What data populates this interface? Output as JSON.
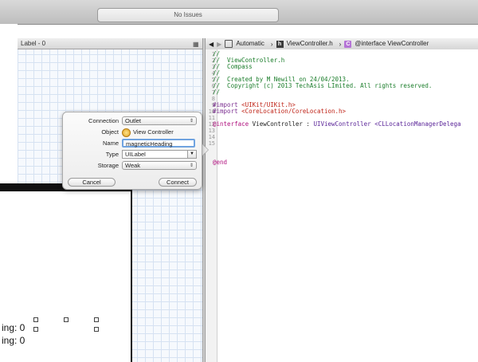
{
  "toolbar": {
    "status_text": "No Issues"
  },
  "canvas": {
    "header_title": "Label - 0",
    "labels": [
      "ing: 0",
      "ing: 0"
    ]
  },
  "jump_bar": {
    "items": [
      "Automatic",
      "ViewController.h",
      "@interface ViewController"
    ]
  },
  "editor": {
    "line_numbers": [
      "1",
      "2",
      "3",
      "4",
      "5",
      "6",
      "7",
      "8",
      "9",
      "10",
      "11",
      "12",
      "13",
      "14",
      "15"
    ],
    "lines": {
      "l1": "//",
      "l2": "//  ViewController.h",
      "l3": "//  Compass",
      "l4": "//",
      "l5": "//  Created by M Newill on 24/04/2013.",
      "l6": "//  Copyright (c) 2013 TechAsis LImited. All rights reserved.",
      "l7": "//",
      "import_kw": "#import",
      "import1_path": "<UIKit/UIKit.h>",
      "import2_path": "<CoreLocation/CoreLocation.h>",
      "iface_kw": "@interface",
      "iface_rest": "ViewController : ",
      "iface_super": "UIViewController",
      "iface_proto": "<CLLocationManagerDelega",
      "end_kw": "@end"
    }
  },
  "connection_popover": {
    "connection_label": "Connection",
    "connection_value": "Outlet",
    "object_label": "Object",
    "object_value": "View Controller",
    "name_label": "Name",
    "name_value": "magneticHeading",
    "type_label": "Type",
    "type_value": "UILabel",
    "storage_label": "Storage",
    "storage_value": "Weak",
    "cancel_label": "Cancel",
    "connect_label": "Connect"
  }
}
